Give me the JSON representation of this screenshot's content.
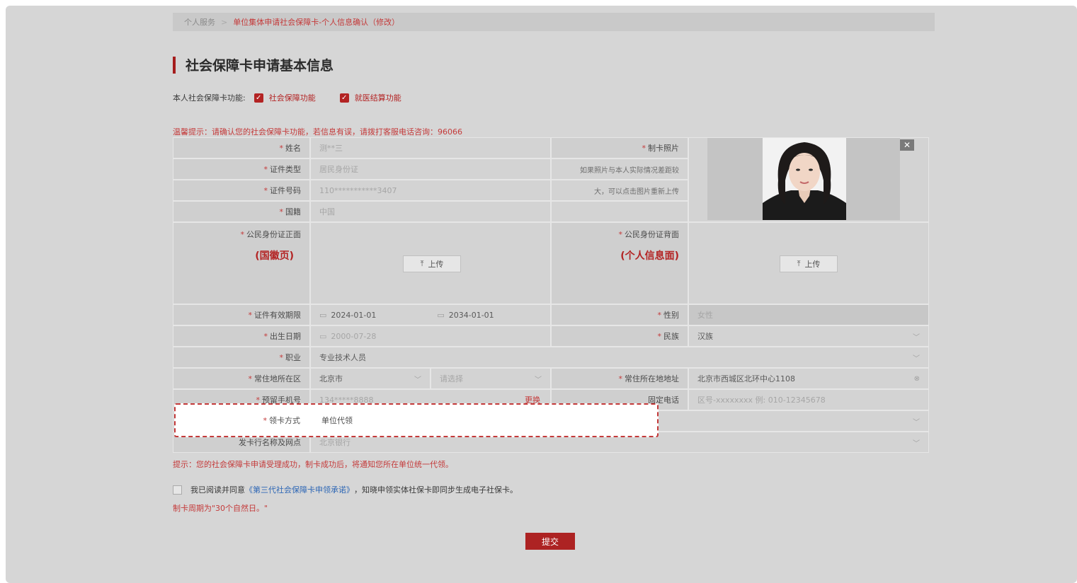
{
  "breadcrumb": {
    "home": "个人服务",
    "current": "单位集体申请社会保障卡-个人信息确认（修改）"
  },
  "section_title": "社会保障卡申请基本信息",
  "card_functions": {
    "label": "本人社会保障卡功能:",
    "option1": "社会保障功能",
    "option2": "就医结算功能"
  },
  "warm_tip": "温馨提示：请确认您的社会保障卡功能，若信息有误，请拨打客服电话咨询：96066",
  "form": {
    "name_label": "姓名",
    "name_value": "测**三",
    "id_type_label": "证件类型",
    "id_type_value": "居民身份证",
    "id_number_label": "证件号码",
    "id_number_value": "110***********3407",
    "nationality_label": "国籍",
    "nationality_value": "中国",
    "photo_label": "制卡照片",
    "photo_hint1": "如果照片与本人实际情况差距较",
    "photo_hint2": "大，可以点击图片重新上传",
    "id_front_label": "公民身份证正面",
    "id_front_sub": "(国徽页)",
    "id_back_label": "公民身份证背面",
    "id_back_sub": "(个人信息面)",
    "upload_label": "上传",
    "validity_label": "证件有效期限",
    "validity_start": "2024-01-01",
    "validity_end": "2034-01-01",
    "gender_label": "性别",
    "gender_value": "女性",
    "birth_label": "出生日期",
    "birth_value": "2000-07-28",
    "ethnicity_label": "民族",
    "ethnicity_value": "汉族",
    "occupation_label": "职业",
    "occupation_value": "专业技术人员",
    "residence_area_label": "常住地所在区",
    "residence_city": "北京市",
    "residence_district_placeholder": "请选择",
    "residence_addr_label": "常住所在地地址",
    "residence_addr_value": "北京市西城区北环中心1108",
    "mobile_label": "预留手机号",
    "mobile_value": "134*****8888",
    "mobile_change": "更换",
    "phone_label": "固定电话",
    "phone_placeholder": "区号-xxxxxxxx 例: 010-12345678",
    "pickup_label": "领卡方式",
    "pickup_value": "单位代领",
    "bank_label": "发卡行名称及网点",
    "bank_value": "北京银行"
  },
  "success_tip": "提示：您的社会保障卡申请受理成功，制卡成功后，将通知您所在单位统一代领。",
  "agreement": {
    "prefix": "我已阅读并同意",
    "link": "《第三代社会保障卡申领承诺》",
    "suffix": "，知晓申领实体社保卡即同步生成电子社保卡。"
  },
  "deadline": "制卡周期为\"30个自然日。\"",
  "submit_label": "提交"
}
